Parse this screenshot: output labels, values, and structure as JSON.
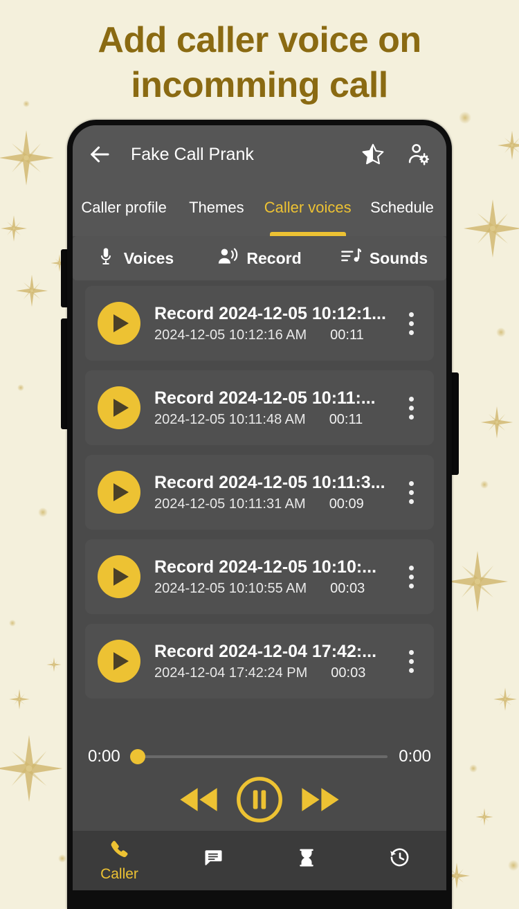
{
  "promo": {
    "headline_line1": "Add caller voice on",
    "headline_line2": "incomming call",
    "headline_color": "#8a6a12",
    "background_color": "#f4f0dc"
  },
  "theme": {
    "accent": "#edc233",
    "screen_bg": "#4a4a4a",
    "bar_bg": "#565656",
    "card_bg": "#505050",
    "nav_bg": "#3b3b3b",
    "text": "#ffffff"
  },
  "appbar": {
    "back_icon": "arrow-left-icon",
    "title": "Fake Call Prank",
    "favorite_icon": "half-star-icon",
    "profile_settings_icon": "person-gear-icon"
  },
  "tabs": {
    "items": [
      {
        "label": "Caller profile",
        "active": false
      },
      {
        "label": "Themes",
        "active": false
      },
      {
        "label": "Caller voices",
        "active": true
      },
      {
        "label": "Schedule",
        "active": false
      }
    ],
    "active_index": 2
  },
  "subbar": {
    "items": [
      {
        "label": "Voices",
        "icon": "microphone-icon"
      },
      {
        "label": "Record",
        "icon": "person-speaking-icon"
      },
      {
        "label": "Sounds",
        "icon": "playlist-music-icon"
      }
    ]
  },
  "recordings": [
    {
      "title": "Record 2024-12-05 10:12:1...",
      "date": "2024-12-05 10:12:16 AM",
      "duration": "00:11"
    },
    {
      "title": "Record 2024-12-05 10:11:...",
      "date": "2024-12-05 10:11:48 AM",
      "duration": "00:11"
    },
    {
      "title": "Record 2024-12-05 10:11:3...",
      "date": "2024-12-05 10:11:31 AM",
      "duration": "00:09"
    },
    {
      "title": "Record 2024-12-05 10:10:...",
      "date": "2024-12-05 10:10:55 AM",
      "duration": "00:03"
    },
    {
      "title": "Record 2024-12-04 17:42:...",
      "date": "2024-12-04 17:42:24 PM",
      "duration": "00:03"
    }
  ],
  "player": {
    "elapsed": "0:00",
    "total": "0:00",
    "progress_percent": 0,
    "rewind_icon": "rewind-icon",
    "pause_icon": "pause-circle-icon",
    "forward_icon": "fast-forward-icon",
    "state": "paused"
  },
  "bottomnav": {
    "items": [
      {
        "label": "Caller",
        "icon": "phone-icon",
        "active": true
      },
      {
        "label": "",
        "icon": "chat-bubble-icon",
        "active": false
      },
      {
        "label": "",
        "icon": "hourglass-icon",
        "active": false
      },
      {
        "label": "",
        "icon": "history-clock-icon",
        "active": false
      }
    ]
  }
}
